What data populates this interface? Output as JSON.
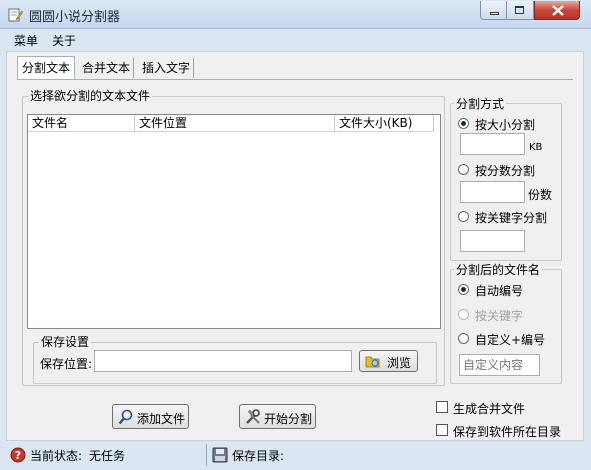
{
  "window": {
    "title": "圆圆小说分割器"
  },
  "menu": {
    "items": [
      "菜单",
      "关于"
    ]
  },
  "tabs": [
    "分割文本",
    "合并文本",
    "插入文字"
  ],
  "file_group": {
    "title": "选择欲分割的文本文件",
    "columns": [
      "文件名",
      "文件位置",
      "文件大小(KB)"
    ],
    "rows": []
  },
  "save": {
    "title": "保存设置",
    "location_label": "保存位置:",
    "location_value": "",
    "browse_label": "浏览"
  },
  "split_method": {
    "title": "分割方式",
    "by_size": "按大小分割",
    "size_value": "",
    "size_unit": "KB",
    "by_count": "按分数分割",
    "count_value": "",
    "count_unit": "份数",
    "by_keyword": "按关键字分割",
    "keyword_value": "",
    "selected": "by_size"
  },
  "naming": {
    "title": "分割后的文件名",
    "auto": "自动编号",
    "keyword": "按关键字",
    "custom": "自定义+编号",
    "custom_placeholder": "自定义内容",
    "selected": "auto"
  },
  "actions": {
    "add_file": "添加文件",
    "start_split": "开始分割"
  },
  "options": {
    "merge_file": "生成合并文件",
    "save_to_app_dir": "保存到软件所在目录",
    "merge_checked": false,
    "app_dir_checked": false
  },
  "status": {
    "current_label": "当前状态:",
    "current_value": "无任务",
    "save_dir_label": "保存目录:",
    "save_dir_value": ""
  },
  "colors": {
    "titlebar": "#c6d8ee",
    "client": "#f0f0f0",
    "close_button": "#c9473a",
    "folder_icon": "#e8b931"
  }
}
